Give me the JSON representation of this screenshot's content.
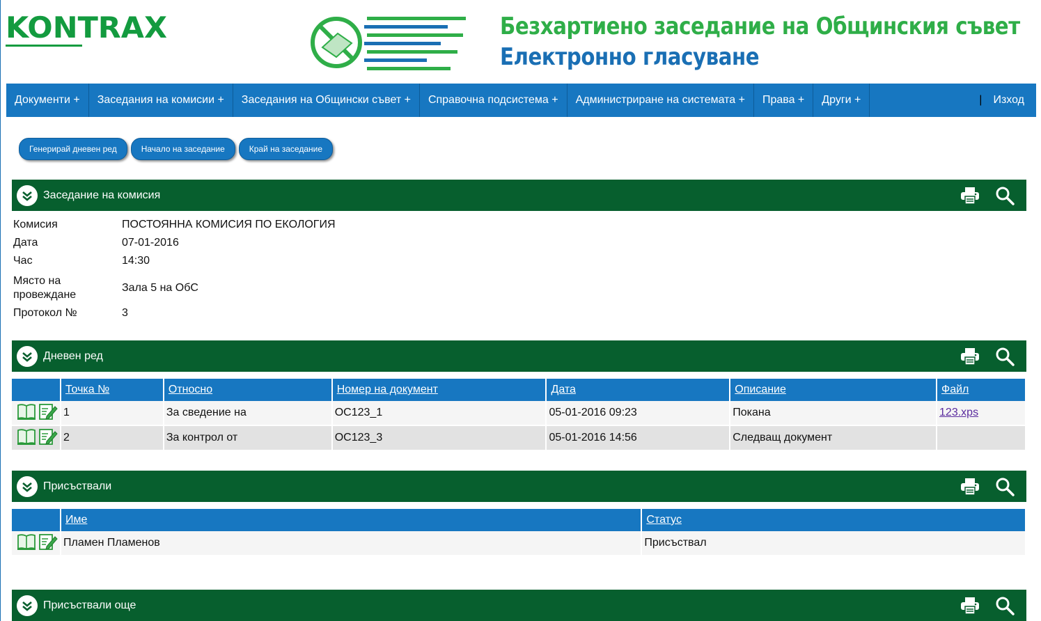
{
  "header": {
    "logo_text": "KONTRAX",
    "title_line1": "Безхартиено заседание на Общинския съвет",
    "title_line2": "Електронно гласуване"
  },
  "nav": {
    "items": [
      {
        "label": "Документи +"
      },
      {
        "label": "Заседания на комисии +"
      },
      {
        "label": "Заседания на Общински съвет +"
      },
      {
        "label": "Справочна подсистема +"
      },
      {
        "label": "Администриране на системата +"
      },
      {
        "label": "Права +"
      },
      {
        "label": "Други +"
      }
    ],
    "separator": "|",
    "logout": "Изход"
  },
  "actions": {
    "generate_agenda": "Генерирай дневен ред",
    "start_meeting": "Начало на заседание",
    "end_meeting": "Край на заседание"
  },
  "sections": {
    "meeting": "Заседание на комисия",
    "agenda": "Дневен ред",
    "present": "Присъствали",
    "present_more": "Присъствали още"
  },
  "meeting_info": {
    "rows": [
      {
        "label": "Комисия",
        "value": "ПОСТОЯННА КОМИСИЯ ПО ЕКОЛОГИЯ"
      },
      {
        "label": "Дата",
        "value": "07-01-2016"
      },
      {
        "label": "Час",
        "value": "14:30"
      },
      {
        "label": "Място на провеждане",
        "value": "Зала 5 на ОбС"
      },
      {
        "label": "Протокол №",
        "value": "3"
      }
    ]
  },
  "agenda_table": {
    "columns": [
      "Точка №",
      "Относно",
      "Номер на документ",
      "Дата",
      "Описание",
      "Файл"
    ],
    "rows": [
      {
        "point": "1",
        "about": "За сведение на",
        "doc_no": "ОС123_1",
        "date": "05-01-2016 09:23",
        "description": "Покана",
        "file": "123.xps"
      },
      {
        "point": "2",
        "about": "За контрол от",
        "doc_no": "ОС123_3",
        "date": "05-01-2016 14:56",
        "description": "Следващ документ",
        "file": ""
      }
    ]
  },
  "attendance_table": {
    "columns": [
      "Име",
      "Статус"
    ],
    "rows": [
      {
        "name": "Пламен Пламенов",
        "status": "Присъствал"
      }
    ]
  },
  "colors": {
    "nav_blue": "#1777c1",
    "section_green": "#075f2e",
    "brand_green": "#2fae48"
  },
  "icons": [
    "chevron-down-icon",
    "print-icon",
    "search-icon",
    "view-book-icon",
    "edit-icon"
  ]
}
